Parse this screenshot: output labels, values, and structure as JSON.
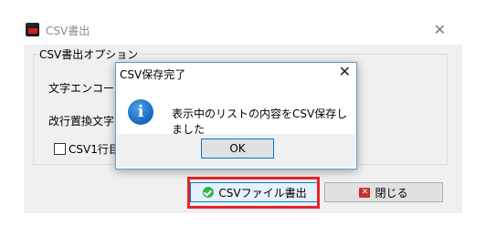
{
  "window": {
    "title": "CSV書出",
    "close_glyph": "✕"
  },
  "options": {
    "group_title": "CSV書出オプション",
    "encoding_label": "文字エンコード",
    "newline_label": "改行置換文字",
    "csv_first_row_label": "CSV1行目"
  },
  "buttons": {
    "csv_export": "CSVファイル書出",
    "close": "閉じる"
  },
  "dialog": {
    "title": "CSV保存完了",
    "close_glyph": "✕",
    "message": "表示中のリストの内容をCSV保存しました",
    "ok": "OK"
  },
  "colors": {
    "highlight": "#e8242c",
    "accent": "#0078d7"
  }
}
